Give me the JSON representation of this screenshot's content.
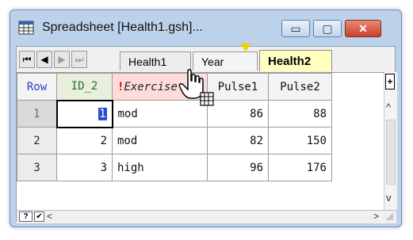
{
  "window": {
    "title": "Spreadsheet [Health1.gsh]...",
    "buttons": {
      "minimize": "▭",
      "maximize": "▢",
      "close": "✕"
    }
  },
  "nav": {
    "first": "⏮",
    "prev": "◀",
    "next": "▶",
    "last": "⏭"
  },
  "tabs": [
    "Health1",
    "Year",
    "Health2"
  ],
  "table": {
    "headers": [
      "Row",
      "ID_2",
      "Exercise",
      "Pulse1",
      "Pulse2"
    ],
    "warn_mark": "!",
    "rows": [
      {
        "row": "1",
        "id": "1",
        "exercise": "mod",
        "pulse1": "86",
        "pulse2": "88"
      },
      {
        "row": "2",
        "id": "2",
        "exercise": "mod",
        "pulse1": "82",
        "pulse2": "150"
      },
      {
        "row": "3",
        "id": "3",
        "exercise": "high",
        "pulse1": "96",
        "pulse2": "176"
      }
    ]
  },
  "scrollbars": {
    "top_button": "+",
    "up": "^",
    "down": "v",
    "left": "<",
    "right": ">"
  },
  "bottom": {
    "help": "?",
    "check": "✔"
  },
  "icons": {
    "app": "spreadsheet-grid-icon",
    "cursor": "hand-cursor-icon"
  },
  "colors": {
    "active_tab": "#ffffc0",
    "id_header": "#e8f0dd",
    "exercise_header": "#ffdcdc",
    "selection": "#2a4cd0"
  }
}
